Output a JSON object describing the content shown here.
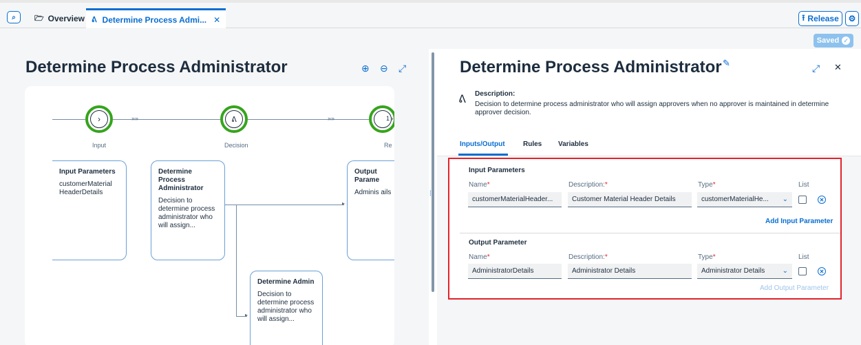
{
  "tabs": {
    "overview_label": "Overview",
    "active_label": "Determine Process Admi...",
    "close_glyph": "✕"
  },
  "toolbar": {
    "release_label": "Release",
    "saved_label": "Saved"
  },
  "left": {
    "title": "Determine Process Administrator",
    "steps": [
      {
        "label": "Input",
        "icon": "chevron-right-icon"
      },
      {
        "label": "Decision",
        "icon": "handshake-icon"
      },
      {
        "label": "Re",
        "icon": "result-icon"
      }
    ],
    "step_badge": "1",
    "cards": {
      "input": {
        "title": "Input Parameters",
        "desc": "customerMaterial HeaderDetails"
      },
      "decision": {
        "title": "Determine Process Administrator",
        "desc": "Decision to determine process administrator who will assign..."
      },
      "output": {
        "title": "Output Parame",
        "desc": "Adminis ails"
      },
      "admin": {
        "title": "Determine Admin",
        "desc": "Decision to determine process administrator who will assign..."
      }
    }
  },
  "right": {
    "title": "Determine Process Administrator",
    "description_label": "Description:",
    "description_text": "Decision to determine process administrator who will assign approvers when no approver is maintained in determine approver decision.",
    "tabs": [
      "Inputs/Output",
      "Rules",
      "Variables"
    ],
    "input_section": {
      "title": "Input Parameters",
      "name_label": "Name",
      "desc_label": "Description:",
      "type_label": "Type",
      "list_label": "List",
      "name_value": "customerMaterialHeader...",
      "desc_value": "Customer Material Header Details",
      "type_value": "customerMaterialHe...",
      "add_label": "Add Input Parameter"
    },
    "output_section": {
      "title": "Output Parameter",
      "name_label": "Name",
      "desc_label": "Description:",
      "type_label": "Type",
      "list_label": "List",
      "name_value": "AdministratorDetails",
      "desc_value": "Administrator Details",
      "type_value": "Administrator Details",
      "add_label": "Add Output Parameter"
    }
  },
  "colors": {
    "accent": "#0a6ed1",
    "success": "#36a41d",
    "highlight": "#e3222b"
  }
}
